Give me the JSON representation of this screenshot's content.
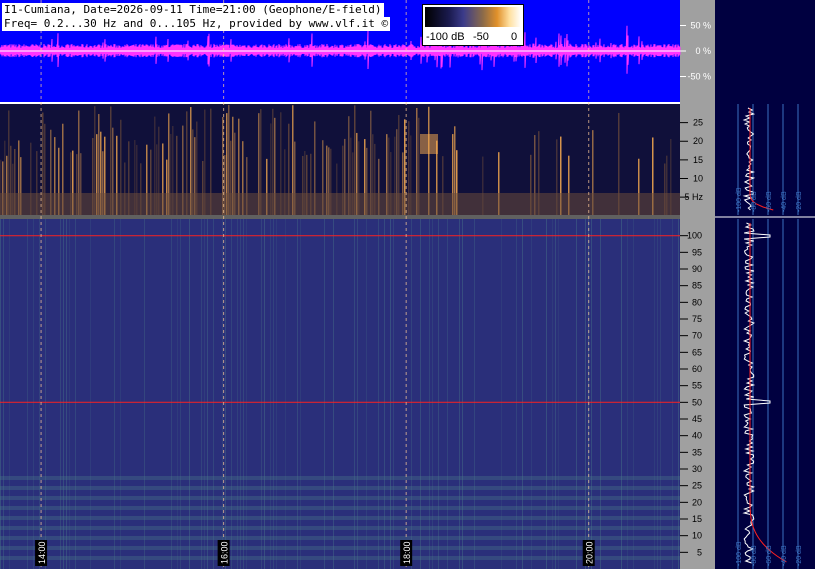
{
  "header": {
    "line1": "I1-Cumiana, Date=2026-09-11 Time=21:00 (Geophone/E-field)",
    "line2": "Freq= 0.2...30 Hz and 0...105 Hz, provided by www.vlf.it ©"
  },
  "colorbar": {
    "labels": [
      "-100 dB",
      "-50",
      "0"
    ]
  },
  "chart_data": [
    {
      "type": "line",
      "panel": "waveform",
      "ylabel": "",
      "ytick_labels": [
        "50 %",
        "0 %",
        "-50 %"
      ],
      "ylim": [
        -100,
        100
      ],
      "grid": true,
      "colors": {
        "background": "#0000ff",
        "trace": "#ff33ff",
        "gridline": "#ff8080"
      }
    },
    {
      "type": "heatmap",
      "panel": "spectrogram-low",
      "ytick_labels": [
        "25",
        "20",
        "15",
        "10",
        "5 Hz"
      ],
      "yticks": [
        25,
        20,
        15,
        10,
        5
      ],
      "ylim": [
        0.2,
        30
      ],
      "colors": {
        "low": "#10103a",
        "mid": "#6a4a3a",
        "high": "#ffb050"
      }
    },
    {
      "type": "heatmap",
      "panel": "spectrogram-high",
      "ytick_labels": [
        "100",
        "95",
        "90",
        "85",
        "80",
        "75",
        "70",
        "65",
        "60",
        "55",
        "50",
        "45",
        "40",
        "35",
        "30",
        "25",
        "20",
        "15",
        "10",
        "5"
      ],
      "yticks": [
        100,
        95,
        90,
        85,
        80,
        75,
        70,
        65,
        60,
        55,
        50,
        45,
        40,
        35,
        30,
        25,
        20,
        15,
        10,
        5
      ],
      "ylim": [
        0,
        105
      ],
      "xtick_labels": [
        "14:00",
        "16:00",
        "18:00",
        "20:00"
      ],
      "xticks": [
        14,
        16,
        18,
        20
      ],
      "xlim": [
        13.55,
        21
      ],
      "highlight_lines_hz": [
        50,
        100
      ],
      "colors": {
        "base": "#2a2f7a",
        "noise": "#4a7a8a",
        "line": "#ff2020"
      }
    },
    {
      "type": "line",
      "panel": "profile-low",
      "xtick_labels": [
        "-100 dB",
        "-80 dB",
        "-60 dB",
        "-40 dB",
        "-20 dB"
      ],
      "colors": {
        "background": "#000040",
        "trace": "#ffffff",
        "trace2": "#ff2020",
        "grid": "#3a70c0"
      }
    },
    {
      "type": "line",
      "panel": "profile-high",
      "xtick_labels": [
        "-100 dB",
        "-80 dB",
        "-60 dB",
        "-40 dB",
        "-20 dB"
      ],
      "peaks_hz": [
        50,
        100
      ],
      "colors": {
        "background": "#000040",
        "trace": "#ffffff",
        "trace2": "#ff2020",
        "grid": "#3a70c0"
      }
    }
  ]
}
